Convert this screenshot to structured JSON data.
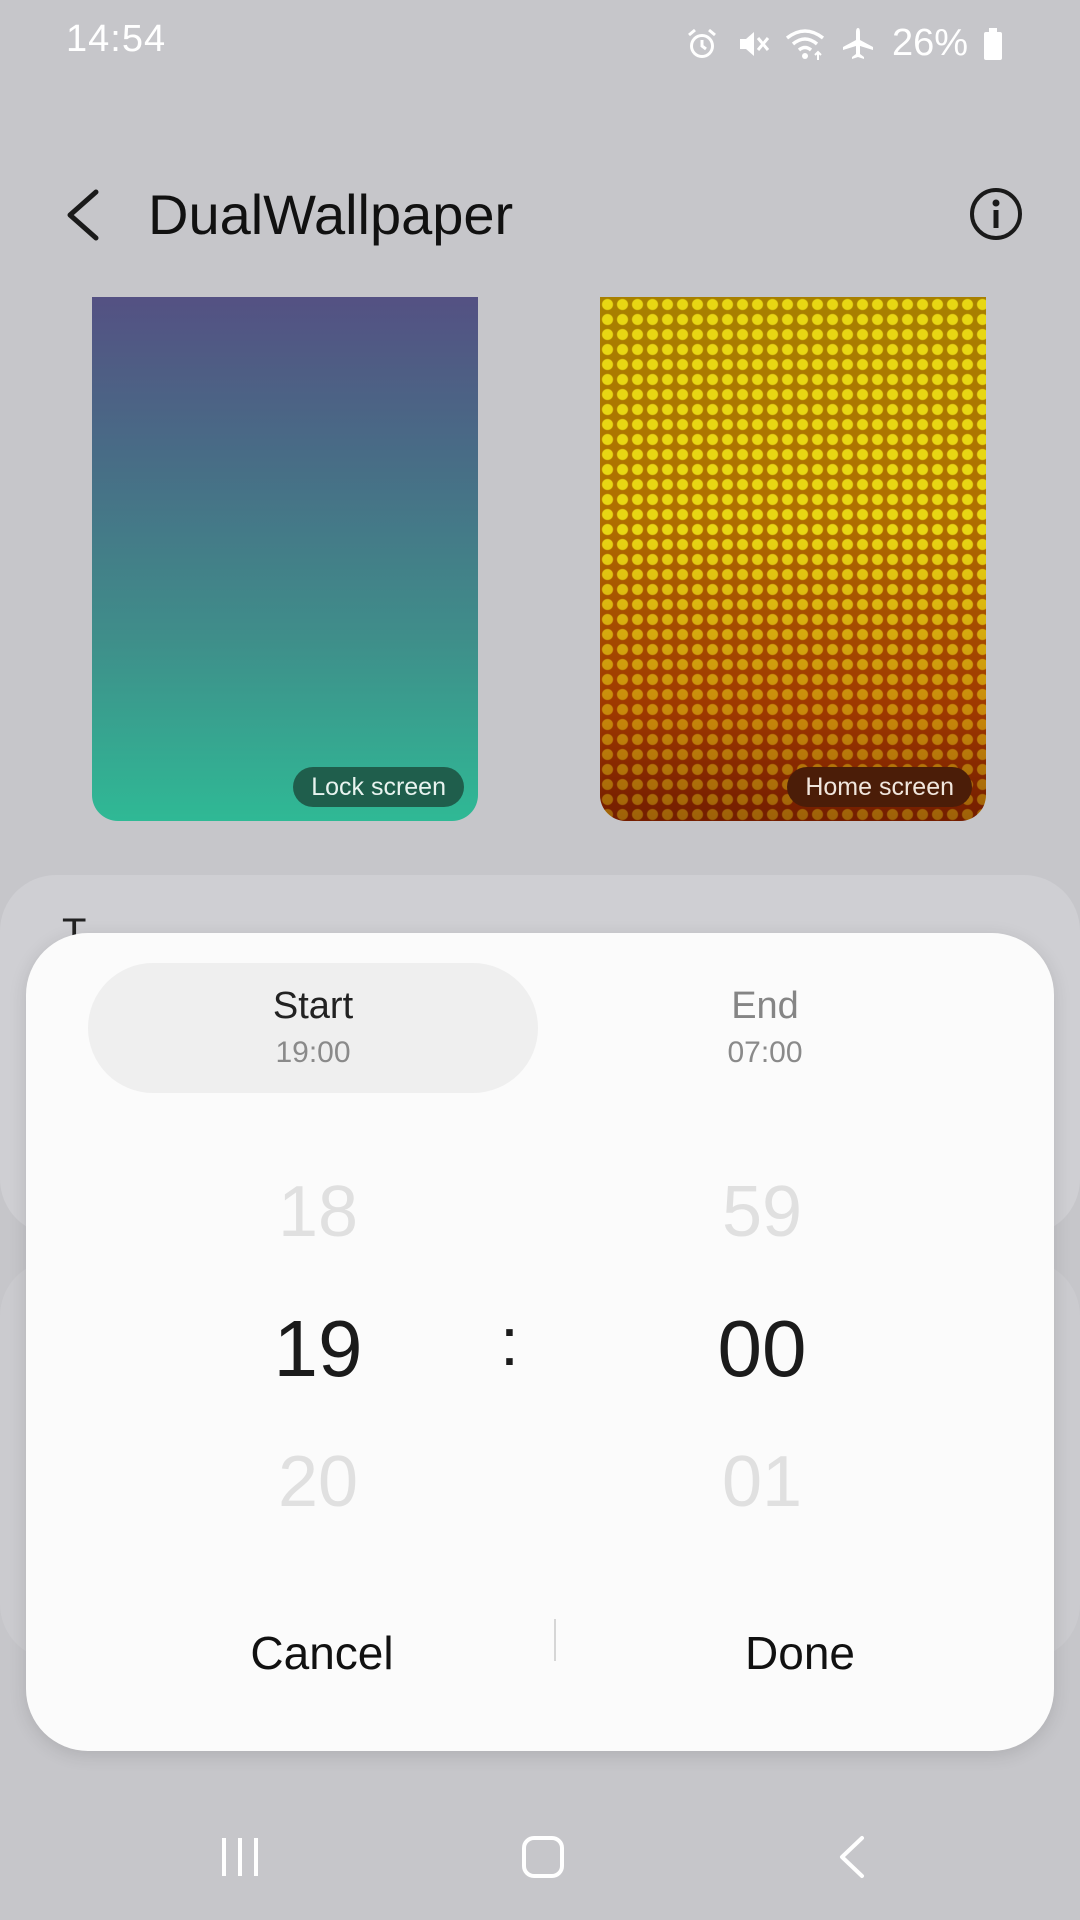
{
  "status_bar": {
    "time": "14:54",
    "icons": [
      "alarm-icon",
      "mute-icon",
      "wifi-icon",
      "airplane-icon",
      "battery-icon"
    ],
    "battery": "26%"
  },
  "app_bar": {
    "title": "DualWallpaper",
    "back_icon": "chevron-left-icon",
    "info_icon": "info-icon"
  },
  "previews": {
    "lock": {
      "label": "Lock screen"
    },
    "home": {
      "label": "Home screen"
    }
  },
  "background_card": {
    "title": "T"
  },
  "time_dialog": {
    "tabs": {
      "start": {
        "label": "Start",
        "time": "19:00"
      },
      "end": {
        "label": "End",
        "time": "07:00"
      }
    },
    "picker": {
      "hour_prev": "18",
      "hour": "19",
      "hour_next": "20",
      "separator": ":",
      "minute_prev": "59",
      "minute": "00",
      "minute_next": "01"
    },
    "buttons": {
      "cancel": "Cancel",
      "done": "Done"
    }
  },
  "nav_bar": {
    "recents_icon": "recents-icon",
    "home_icon": "home-icon",
    "back_icon": "back-icon"
  },
  "colors": {
    "background": "#c6c6ca",
    "dialog": "#fbfbfb",
    "lock_gradient_top": "#545183",
    "lock_gradient_bottom": "#2fb995"
  }
}
